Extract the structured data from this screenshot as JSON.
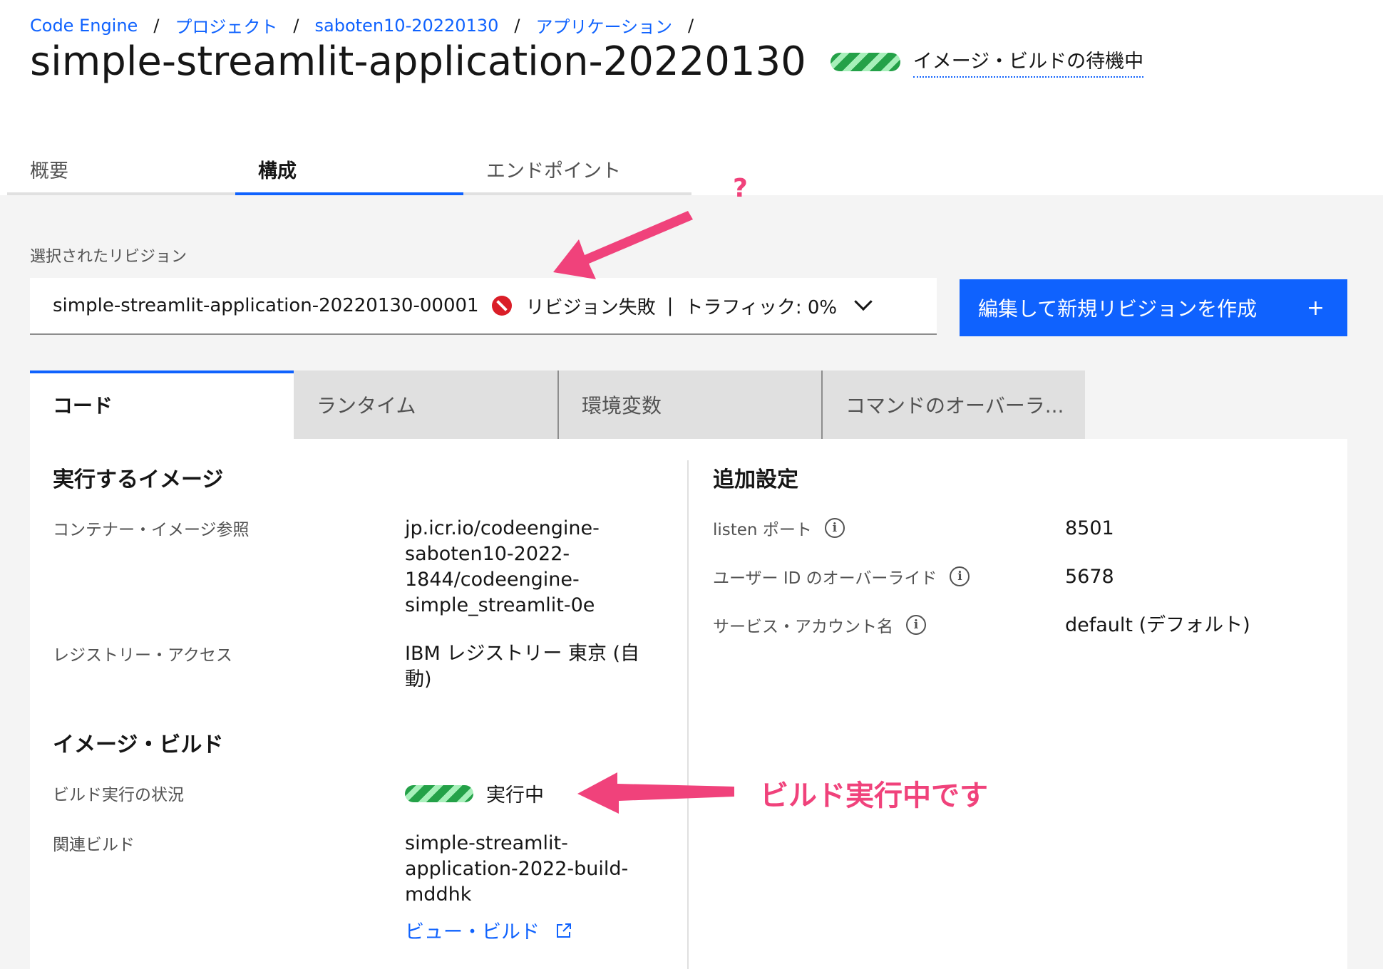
{
  "breadcrumb": {
    "items": [
      "Code Engine",
      "プロジェクト",
      "saboten10-20220130",
      "アプリケーション"
    ],
    "separator": "/"
  },
  "header": {
    "title": "simple-streamlit-application-20220130",
    "status": "イメージ・ビルドの待機中"
  },
  "tabs": [
    {
      "label": "概要",
      "active": false
    },
    {
      "label": "構成",
      "active": true
    },
    {
      "label": "エンドポイント",
      "active": false
    }
  ],
  "revision": {
    "label": "選択されたリビジョン",
    "name": "simple-streamlit-application-20220130-00001",
    "status": "リビジョン失敗",
    "separator": "|",
    "traffic": "トラフィック: 0%"
  },
  "edit_button": {
    "label": "編集して新規リビジョンを作成",
    "plus": "+"
  },
  "content_tabs": [
    "コード",
    "ランタイム",
    "環境変数",
    "コマンドのオーバーラ..."
  ],
  "left": {
    "image_heading": "実行するイメージ",
    "container_label": "コンテナー・イメージ参照",
    "container_value": [
      "jp.icr.io/codeengine-",
      "saboten10-2022-",
      "1844/codeengine-",
      "simple_streamlit-0e"
    ],
    "registry_label": "レジストリー・アクセス",
    "registry_value": [
      "IBM レジストリー 東京 (自",
      "動)"
    ],
    "build_heading": "イメージ・ビルド",
    "build_status_label": "ビルド実行の状況",
    "build_status_value": "実行中",
    "related_build_label": "関連ビルド",
    "related_build_value": [
      "simple-streamlit-",
      "application-2022-build-",
      "mddhk"
    ],
    "view_build_link": "ビュー・ビルド"
  },
  "right": {
    "heading": "追加設定",
    "listen_port_label": "listen ポート",
    "listen_port_value": "8501",
    "user_id_label": "ユーザー ID のオーバーライド",
    "user_id_value": "5678",
    "service_account_label": "サービス・アカウント名",
    "service_account_value": "default (デフォルト)"
  },
  "annotations": {
    "question": "?",
    "build_running_note": "ビルド実行中です"
  },
  "colors": {
    "accent": "#0f62fe",
    "error": "#da1e28",
    "success": "#24a148",
    "annotation": "#f0427b"
  }
}
